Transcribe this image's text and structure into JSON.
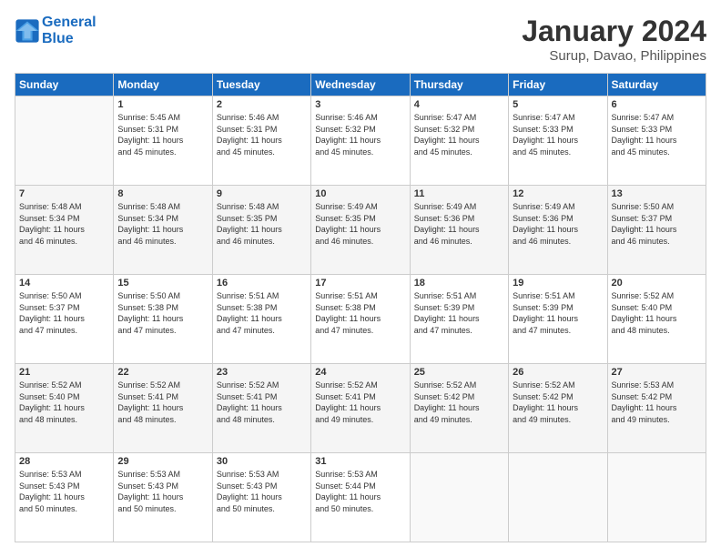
{
  "header": {
    "logo_line1": "General",
    "logo_line2": "Blue",
    "title": "January 2024",
    "subtitle": "Surup, Davao, Philippines"
  },
  "columns": [
    "Sunday",
    "Monday",
    "Tuesday",
    "Wednesday",
    "Thursday",
    "Friday",
    "Saturday"
  ],
  "weeks": [
    [
      {
        "day": "",
        "text": ""
      },
      {
        "day": "1",
        "text": "Sunrise: 5:45 AM\nSunset: 5:31 PM\nDaylight: 11 hours\nand 45 minutes."
      },
      {
        "day": "2",
        "text": "Sunrise: 5:46 AM\nSunset: 5:31 PM\nDaylight: 11 hours\nand 45 minutes."
      },
      {
        "day": "3",
        "text": "Sunrise: 5:46 AM\nSunset: 5:32 PM\nDaylight: 11 hours\nand 45 minutes."
      },
      {
        "day": "4",
        "text": "Sunrise: 5:47 AM\nSunset: 5:32 PM\nDaylight: 11 hours\nand 45 minutes."
      },
      {
        "day": "5",
        "text": "Sunrise: 5:47 AM\nSunset: 5:33 PM\nDaylight: 11 hours\nand 45 minutes."
      },
      {
        "day": "6",
        "text": "Sunrise: 5:47 AM\nSunset: 5:33 PM\nDaylight: 11 hours\nand 45 minutes."
      }
    ],
    [
      {
        "day": "7",
        "text": "Sunrise: 5:48 AM\nSunset: 5:34 PM\nDaylight: 11 hours\nand 46 minutes."
      },
      {
        "day": "8",
        "text": "Sunrise: 5:48 AM\nSunset: 5:34 PM\nDaylight: 11 hours\nand 46 minutes."
      },
      {
        "day": "9",
        "text": "Sunrise: 5:48 AM\nSunset: 5:35 PM\nDaylight: 11 hours\nand 46 minutes."
      },
      {
        "day": "10",
        "text": "Sunrise: 5:49 AM\nSunset: 5:35 PM\nDaylight: 11 hours\nand 46 minutes."
      },
      {
        "day": "11",
        "text": "Sunrise: 5:49 AM\nSunset: 5:36 PM\nDaylight: 11 hours\nand 46 minutes."
      },
      {
        "day": "12",
        "text": "Sunrise: 5:49 AM\nSunset: 5:36 PM\nDaylight: 11 hours\nand 46 minutes."
      },
      {
        "day": "13",
        "text": "Sunrise: 5:50 AM\nSunset: 5:37 PM\nDaylight: 11 hours\nand 46 minutes."
      }
    ],
    [
      {
        "day": "14",
        "text": "Sunrise: 5:50 AM\nSunset: 5:37 PM\nDaylight: 11 hours\nand 47 minutes."
      },
      {
        "day": "15",
        "text": "Sunrise: 5:50 AM\nSunset: 5:38 PM\nDaylight: 11 hours\nand 47 minutes."
      },
      {
        "day": "16",
        "text": "Sunrise: 5:51 AM\nSunset: 5:38 PM\nDaylight: 11 hours\nand 47 minutes."
      },
      {
        "day": "17",
        "text": "Sunrise: 5:51 AM\nSunset: 5:38 PM\nDaylight: 11 hours\nand 47 minutes."
      },
      {
        "day": "18",
        "text": "Sunrise: 5:51 AM\nSunset: 5:39 PM\nDaylight: 11 hours\nand 47 minutes."
      },
      {
        "day": "19",
        "text": "Sunrise: 5:51 AM\nSunset: 5:39 PM\nDaylight: 11 hours\nand 47 minutes."
      },
      {
        "day": "20",
        "text": "Sunrise: 5:52 AM\nSunset: 5:40 PM\nDaylight: 11 hours\nand 48 minutes."
      }
    ],
    [
      {
        "day": "21",
        "text": "Sunrise: 5:52 AM\nSunset: 5:40 PM\nDaylight: 11 hours\nand 48 minutes."
      },
      {
        "day": "22",
        "text": "Sunrise: 5:52 AM\nSunset: 5:41 PM\nDaylight: 11 hours\nand 48 minutes."
      },
      {
        "day": "23",
        "text": "Sunrise: 5:52 AM\nSunset: 5:41 PM\nDaylight: 11 hours\nand 48 minutes."
      },
      {
        "day": "24",
        "text": "Sunrise: 5:52 AM\nSunset: 5:41 PM\nDaylight: 11 hours\nand 49 minutes."
      },
      {
        "day": "25",
        "text": "Sunrise: 5:52 AM\nSunset: 5:42 PM\nDaylight: 11 hours\nand 49 minutes."
      },
      {
        "day": "26",
        "text": "Sunrise: 5:52 AM\nSunset: 5:42 PM\nDaylight: 11 hours\nand 49 minutes."
      },
      {
        "day": "27",
        "text": "Sunrise: 5:53 AM\nSunset: 5:42 PM\nDaylight: 11 hours\nand 49 minutes."
      }
    ],
    [
      {
        "day": "28",
        "text": "Sunrise: 5:53 AM\nSunset: 5:43 PM\nDaylight: 11 hours\nand 50 minutes."
      },
      {
        "day": "29",
        "text": "Sunrise: 5:53 AM\nSunset: 5:43 PM\nDaylight: 11 hours\nand 50 minutes."
      },
      {
        "day": "30",
        "text": "Sunrise: 5:53 AM\nSunset: 5:43 PM\nDaylight: 11 hours\nand 50 minutes."
      },
      {
        "day": "31",
        "text": "Sunrise: 5:53 AM\nSunset: 5:44 PM\nDaylight: 11 hours\nand 50 minutes."
      },
      {
        "day": "",
        "text": ""
      },
      {
        "day": "",
        "text": ""
      },
      {
        "day": "",
        "text": ""
      }
    ]
  ]
}
